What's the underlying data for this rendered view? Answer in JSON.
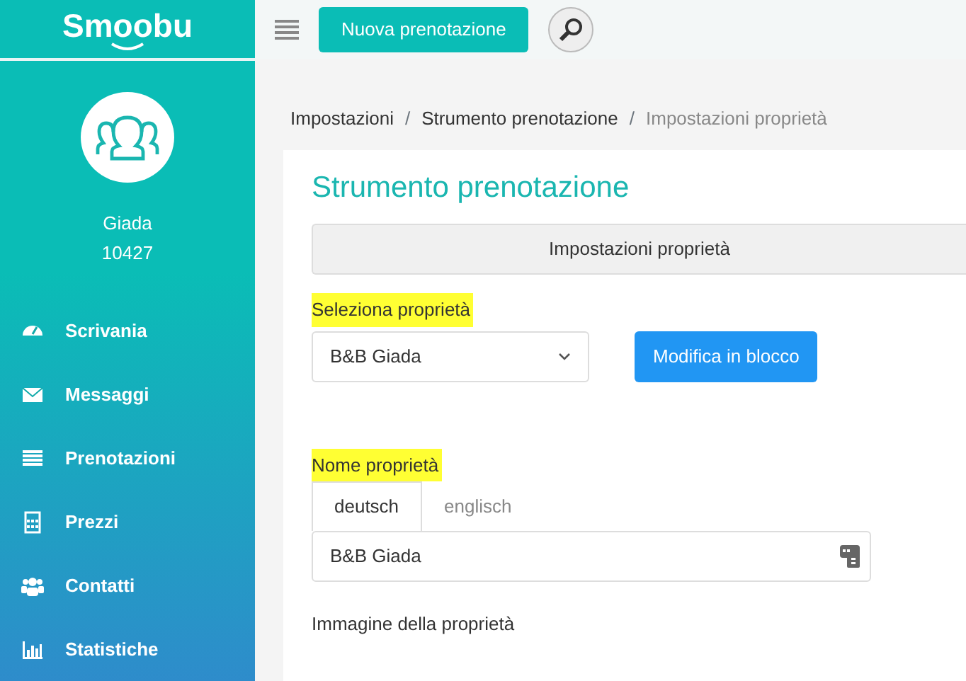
{
  "logo": {
    "text": "Smoobu"
  },
  "topbar": {
    "new_booking_button": "Nuova prenotazione"
  },
  "user": {
    "name": "Giada",
    "id": "10427"
  },
  "sidebar": {
    "items": [
      {
        "label": "Scrivania"
      },
      {
        "label": "Messaggi"
      },
      {
        "label": "Prenotazioni"
      },
      {
        "label": "Prezzi"
      },
      {
        "label": "Contatti"
      },
      {
        "label": "Statistiche"
      }
    ]
  },
  "breadcrumb": [
    {
      "label": "Impostazioni",
      "current": false
    },
    {
      "separator": "/",
      "label": "Strumento prenotazione",
      "current": false
    },
    {
      "separator": "/",
      "label": "Impostazioni proprietà",
      "current": true
    }
  ],
  "page_title": "Strumento prenotazione",
  "section_bar": "Impostazioni proprietà",
  "property_select": {
    "label": "Seleziona proprietà",
    "highlighted": true,
    "value": "B&B Giada",
    "button": "Modifica in blocco"
  },
  "property_name": {
    "label": "Nome proprietà",
    "highlighted": true,
    "tabs": [
      {
        "label": "deutsch",
        "selected": true
      },
      {
        "label": "englisch",
        "selected": false
      }
    ],
    "value": "B&B Giada"
  },
  "property_image": {
    "label": "Immagine della proprietà",
    "highlighted": false
  }
}
